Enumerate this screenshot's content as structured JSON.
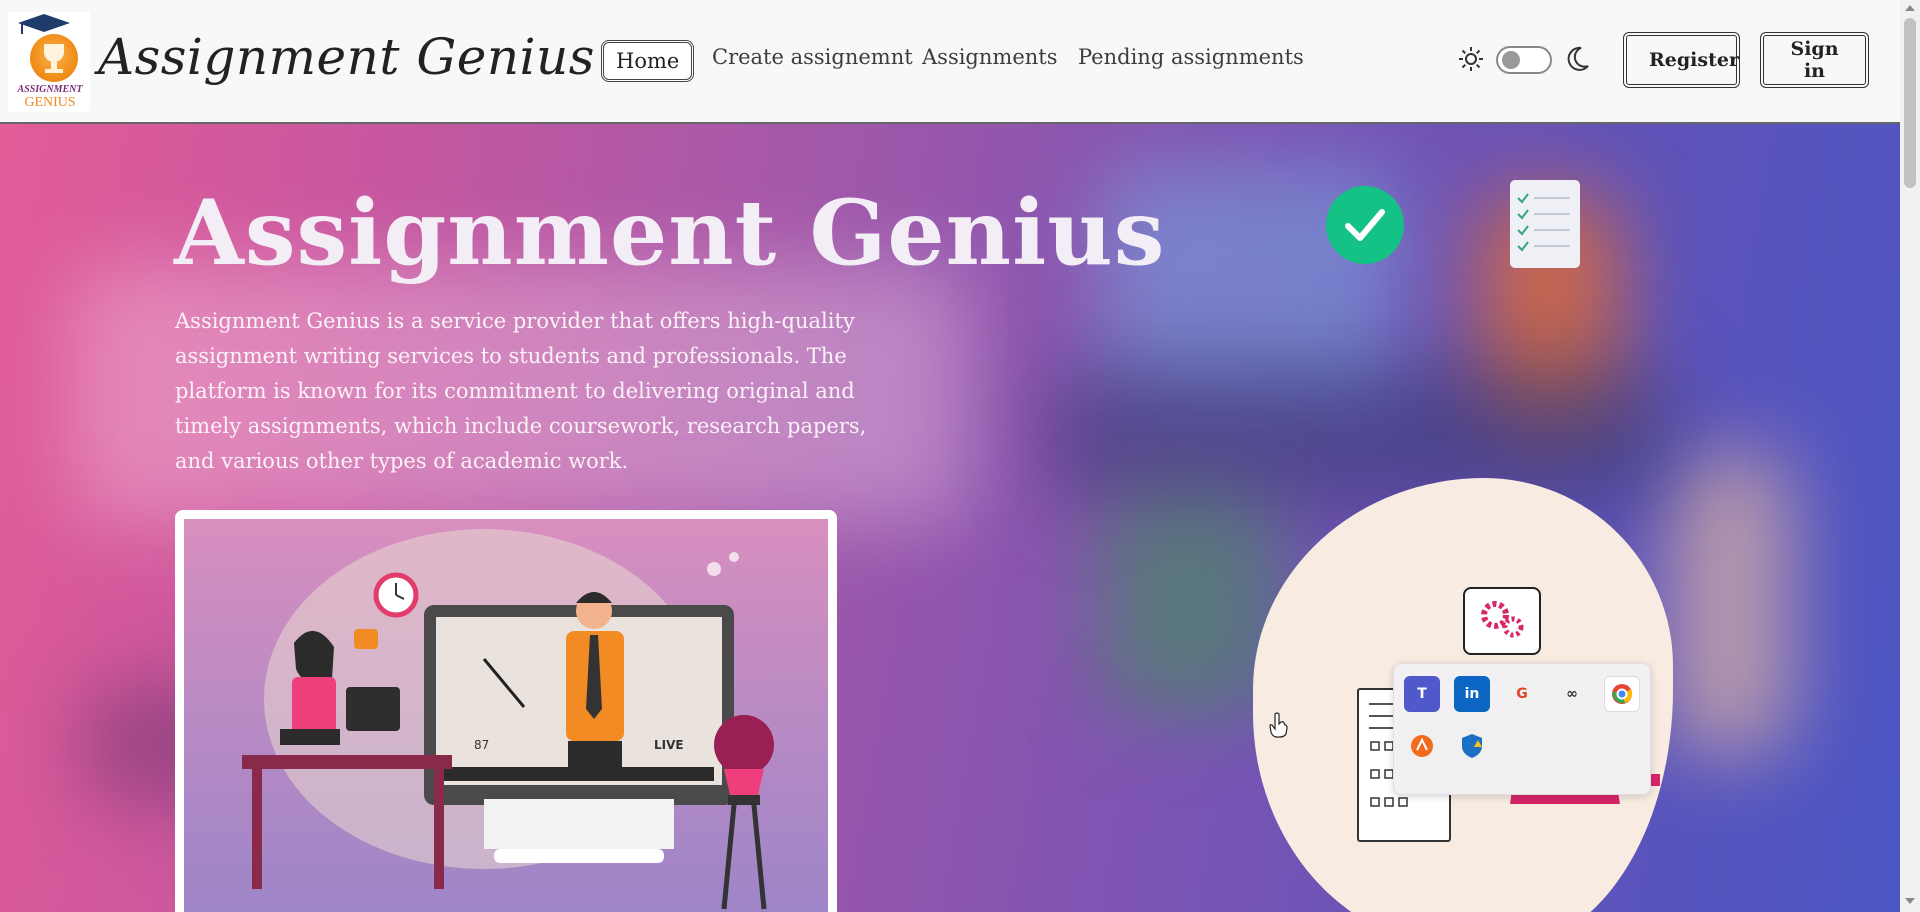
{
  "brand": {
    "name": "Assignment Genius",
    "logo_line1": "ASSIGNMENT",
    "logo_line2": "GENIUS"
  },
  "nav": {
    "items": [
      {
        "label": "Home",
        "active": true
      },
      {
        "label": "Create assignemnt"
      },
      {
        "label": "Assignments"
      },
      {
        "label": "Pending assignments"
      }
    ]
  },
  "theme_toggle": {
    "sun_icon": "sun-icon",
    "moon_icon": "moon-icon",
    "dark_mode": false
  },
  "auth": {
    "register_label": "Register",
    "signin_label": "Sign in"
  },
  "hero": {
    "title": "Assignment Genius",
    "description": "Assignment Genius is a service provider that offers high-quality assignment writing services to students and professionals. The platform is known for its commitment to delivering original and timely assignments, which include coursework, research papers, and various other types of academic work.",
    "illustration_viewers": "87",
    "illustration_live": "LIVE"
  },
  "tray": {
    "icons": [
      "teams-icon",
      "linkedin-icon",
      "git-icon",
      "creative-cloud-icon",
      "chrome-icon",
      "avast-icon",
      "defender-icon"
    ]
  },
  "colors": {
    "accent_green": "#15c286",
    "hero_pink": "#e25c98",
    "hero_blue": "#4b56c4",
    "logo_orange": "#f18f1c"
  }
}
